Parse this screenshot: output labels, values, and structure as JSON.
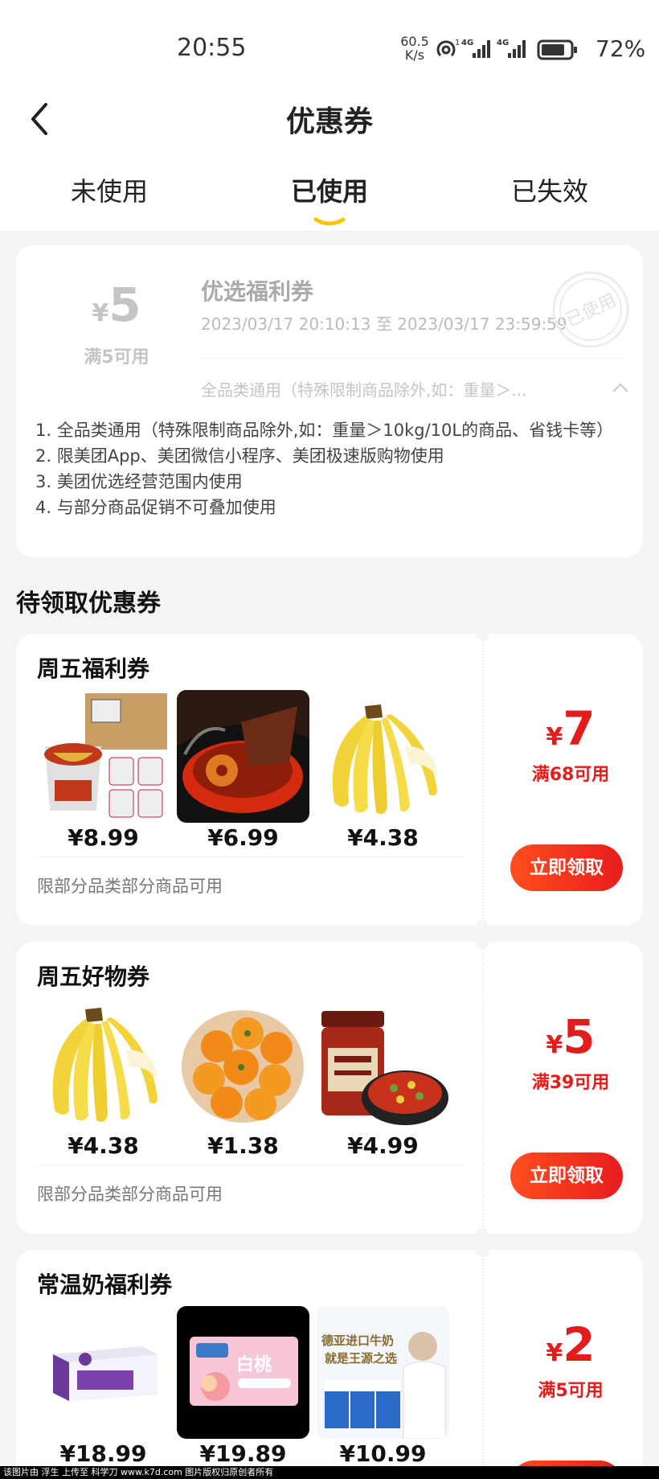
{
  "status_bar": {
    "time": "20:55",
    "net_speed_value": "60.5",
    "net_speed_unit": "K/s",
    "battery": "72%",
    "icons": [
      "hotspot-icon",
      "signal-4g-icon",
      "signal-4g-icon",
      "battery-icon"
    ]
  },
  "nav": {
    "back_icon": "chevron-left-icon",
    "title": "优惠券"
  },
  "tabs": [
    {
      "label": "未使用",
      "active": false
    },
    {
      "label": "已使用",
      "active": true
    },
    {
      "label": "已失效",
      "active": false
    }
  ],
  "accent_color": "#ffc300",
  "used_coupon": {
    "currency": "¥",
    "amount": "5",
    "condition": "满5可用",
    "name": "优选福利券",
    "validity": "2023/03/17 20:10:13 至 2023/03/17 23:59:59",
    "scope": "全品类通用（特殊限制商品除外,如：重量＞...",
    "stamp_text": "已使用",
    "rules": [
      "1. 全品类通用（特殊限制商品除外,如：重量＞10kg/10L的商品、省钱卡等）",
      "2. 限美团App、美团微信小程序、美团极速版购物使用",
      "3. 美团优选经营范围内使用",
      "4. 与部分商品促销不可叠加使用"
    ]
  },
  "section_title": "待领取优惠券",
  "offers": [
    {
      "title": "周五福利券",
      "products": [
        {
          "price": "¥8.99",
          "image": "noodle-box-image"
        },
        {
          "price": "¥6.99",
          "image": "hotpot-image"
        },
        {
          "price": "¥4.38",
          "image": "banana-image"
        }
      ],
      "note": "限部分品类部分商品可用",
      "currency": "¥",
      "amount": "7",
      "condition": "满68可用",
      "button": "立即领取"
    },
    {
      "title": "周五好物券",
      "products": [
        {
          "price": "¥4.38",
          "image": "banana-image"
        },
        {
          "price": "¥1.38",
          "image": "orange-bowl-image"
        },
        {
          "price": "¥4.99",
          "image": "chili-sauce-jar-image"
        }
      ],
      "note": "限部分品类部分商品可用",
      "currency": "¥",
      "amount": "5",
      "condition": "满39可用",
      "button": "立即领取"
    },
    {
      "title": "常温奶福利券",
      "products": [
        {
          "price": "¥18.99",
          "image": "milk-carton-box-image"
        },
        {
          "price": "¥19.89",
          "image": "peach-milk-pack-image"
        },
        {
          "price": "¥10.99",
          "image": "imported-milk-ad-image",
          "ad_text_1": "德亚进口牛奶",
          "ad_text_2": "就是王源之选"
        }
      ],
      "currency": "¥",
      "amount": "2",
      "condition": "满5可用"
    }
  ],
  "footer": "该图片由 浮生 上传至 科学刀 www.k7d.com 图片版权归原创者所有"
}
